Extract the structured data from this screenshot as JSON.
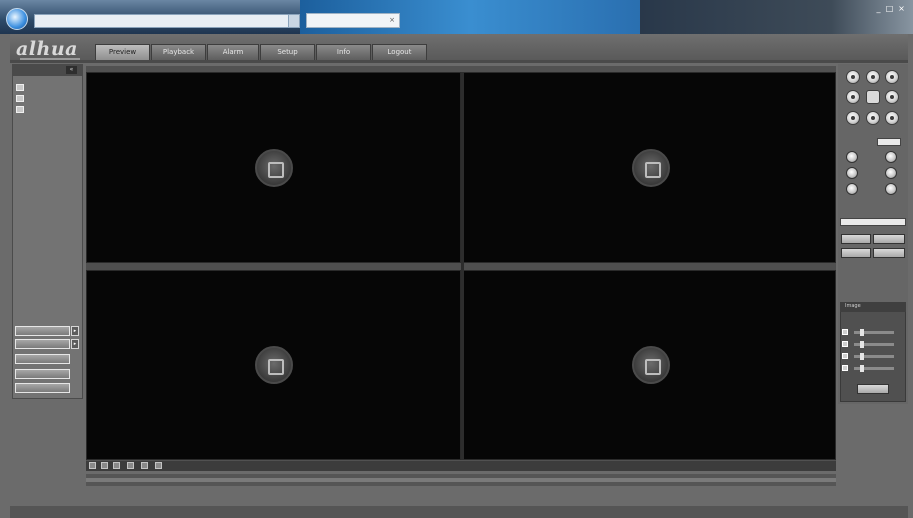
{
  "browser": {
    "address_text": "",
    "tab_title": "",
    "window_buttons": [
      "_",
      "□",
      "×"
    ]
  },
  "app": {
    "logo_text": "alhua"
  },
  "nav_tabs": [
    {
      "label": "Preview",
      "active": true
    },
    {
      "label": "Playback",
      "active": false
    },
    {
      "label": "Alarm",
      "active": false
    },
    {
      "label": "Setup",
      "active": false
    },
    {
      "label": "Info",
      "active": false
    },
    {
      "label": "Logout",
      "active": false
    }
  ],
  "left_panel": {
    "title": "",
    "collapse_icon": "«",
    "tree_items": [
      {
        "label": ""
      },
      {
        "label": ""
      },
      {
        "label": ""
      }
    ],
    "buttons": [
      {
        "label": ""
      },
      {
        "label": ""
      },
      {
        "label": ""
      },
      {
        "label": ""
      },
      {
        "label": ""
      }
    ]
  },
  "video_tiles": [
    {
      "title": ""
    },
    {
      "title": ""
    },
    {
      "title": ""
    },
    {
      "title": ""
    }
  ],
  "ptz": {
    "speed_label": "",
    "speed_value": "",
    "zoom_label": "",
    "focus_label": "",
    "iris_label": "",
    "preset_label": "",
    "tour_label": "",
    "preset_select": "",
    "buttons": [
      "",
      "",
      "",
      ""
    ]
  },
  "image_panel": {
    "title": "Image",
    "rows": [
      {
        "icon": "brightness-icon",
        "value": ""
      },
      {
        "icon": "contrast-icon",
        "value": ""
      },
      {
        "icon": "saturation-icon",
        "value": ""
      },
      {
        "icon": "hue-icon",
        "value": ""
      }
    ],
    "reset_label": ""
  },
  "colors": {
    "background": "#6b6b6b",
    "video_bg": "#060606",
    "chrome_blue": "#2d4a68"
  }
}
